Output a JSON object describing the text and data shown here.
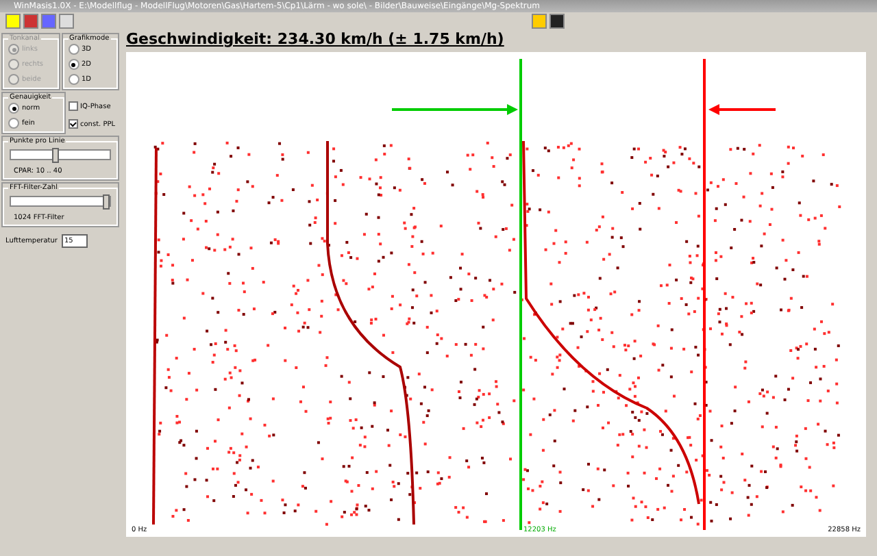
{
  "window": {
    "title": "WinMasis1.0X - E:\\Modellflug - ModellFlug\\Motoren\\Gas\\Hartem-5\\Cp1\\Lärm - wo sole\\ - Bilder\\Bauweise\\Eingänge\\Mg-Spektrum"
  },
  "heading": "Geschwindigkeit: 234.30 km/h (± 1.75 km/h)",
  "groups": [
    {
      "title": "Tonkanal",
      "disabled": true,
      "options": [
        {
          "label": "links",
          "selected": true
        },
        {
          "label": "rechts",
          "selected": false
        },
        {
          "label": "beide",
          "selected": false
        }
      ]
    },
    {
      "title": "Grafikmode",
      "disabled": false,
      "options": [
        {
          "label": "3D",
          "selected": false
        },
        {
          "label": "2D",
          "selected": true
        },
        {
          "label": "1D",
          "selected": false
        }
      ]
    },
    {
      "title": "Genauigkeit",
      "disabled": false,
      "options": [
        {
          "label": "norm",
          "selected": true
        },
        {
          "label": "fein",
          "selected": false
        }
      ]
    }
  ],
  "checkboxes": [
    {
      "label": "IQ-Phase",
      "checked": false
    },
    {
      "label": "const. PPL",
      "checked": true
    }
  ],
  "sliders": [
    {
      "title": "Punkte pro Linie",
      "level": 0.45,
      "caption": "CPAR: 10 .. 40"
    },
    {
      "title": "FFT-Filter-Zahl",
      "level": 1,
      "caption": "1024 FFT-Filter"
    }
  ],
  "temperature": {
    "label": "Lufttemperatur",
    "value": "15"
  },
  "plot": {
    "axis_left": "0 Hz",
    "marker_label": "12203 Hz",
    "axis_right": "22858 Hz"
  }
}
